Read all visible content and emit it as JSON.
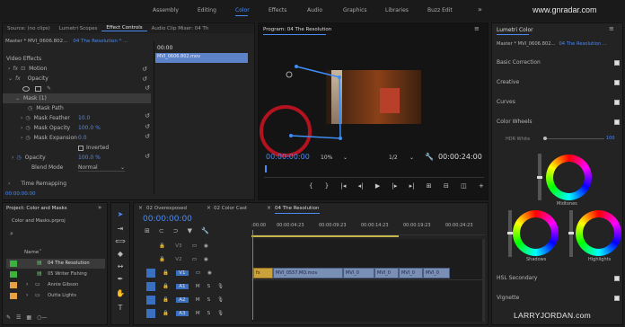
{
  "workspaces": {
    "items": [
      "Assembly",
      "Editing",
      "Color",
      "Effects",
      "Audio",
      "Graphics",
      "Libraries",
      "Buzz Edit"
    ],
    "active": "Color",
    "more": "»"
  },
  "watermark_top": "www.gnradar.com",
  "watermark_bottom": "LARRYJORDAN.com",
  "effect_controls": {
    "tabs": [
      "Source: (no clips)",
      "Lumetri Scopes",
      "Effect Controls",
      "Audio Clip Mixer: 04 Th"
    ],
    "master": "Master * MVI_0606.802...",
    "sequence": "04 The Resolution * ...",
    "timecode": "00:00",
    "clip_name": "MVI_0606.802.mov",
    "video_effects": "Video Effects",
    "motion": "Motion",
    "opacity": "Opacity",
    "mask": "Mask (1)",
    "mask_path": "Mask Path",
    "mask_feather_label": "Mask Feather",
    "mask_feather": "10.0",
    "mask_opacity_label": "Mask Opacity",
    "mask_opacity": "100.0 %",
    "mask_expansion_label": "Mask Expansion",
    "mask_expansion": "0.0",
    "inverted": "Inverted",
    "opacity_label": "Opacity",
    "opacity_value": "100.0 %",
    "blend_label": "Blend Mode",
    "blend_value": "Normal",
    "time_remap": "Time Remapping",
    "bottom_tc": "00:00:00:00"
  },
  "program": {
    "title": "Program: 04 The Resolution",
    "timecode": "00:00:00:00",
    "zoom": "10%",
    "quality": "1/2",
    "duration": "00:00:24:00"
  },
  "lumetri": {
    "title": "Lumetri Color",
    "master": "Master * MVI_0606.802...",
    "sequence": "04 The Resolution ...",
    "sections": {
      "basic": "Basic Correction",
      "creative": "Creative",
      "curves": "Curves",
      "wheels": "Color Wheels",
      "hsl": "HSL Secondary",
      "vignette": "Vignette"
    },
    "hdr_label": "HDR White",
    "hdr_value": "100",
    "midtones": "Midtones",
    "shadows": "Shadows",
    "highlights": "Highlights"
  },
  "project": {
    "title": "Project: Color and Masks",
    "file": "Color and Masks.prproj",
    "name_header": "Name",
    "items": [
      "04 The Resolution",
      "05 Writer Fishing",
      "Annie Gibson",
      "Outta Lights"
    ],
    "item_colors": [
      "#3db33d",
      "#3db33d",
      "#e8a040",
      "#e8a040"
    ]
  },
  "timeline": {
    "tabs": [
      "02 Overexposed",
      "02 Color Cast",
      "04 The Resolution"
    ],
    "timecode": "00:00:00:00",
    "ruler": [
      ":00:00",
      "00:00:04:23",
      "00:00:09:23",
      "00:00:14:23",
      "00:00:19:23",
      "00:00:24:23"
    ],
    "tracks": [
      "V3",
      "V2",
      "V1",
      "A1",
      "A2",
      "A3"
    ],
    "clips": [
      "MVI_0557.MO.mov",
      "MVI_0",
      "MVI_0",
      "MVI_0",
      "MVI_0"
    ],
    "fx_marker": "fx"
  }
}
